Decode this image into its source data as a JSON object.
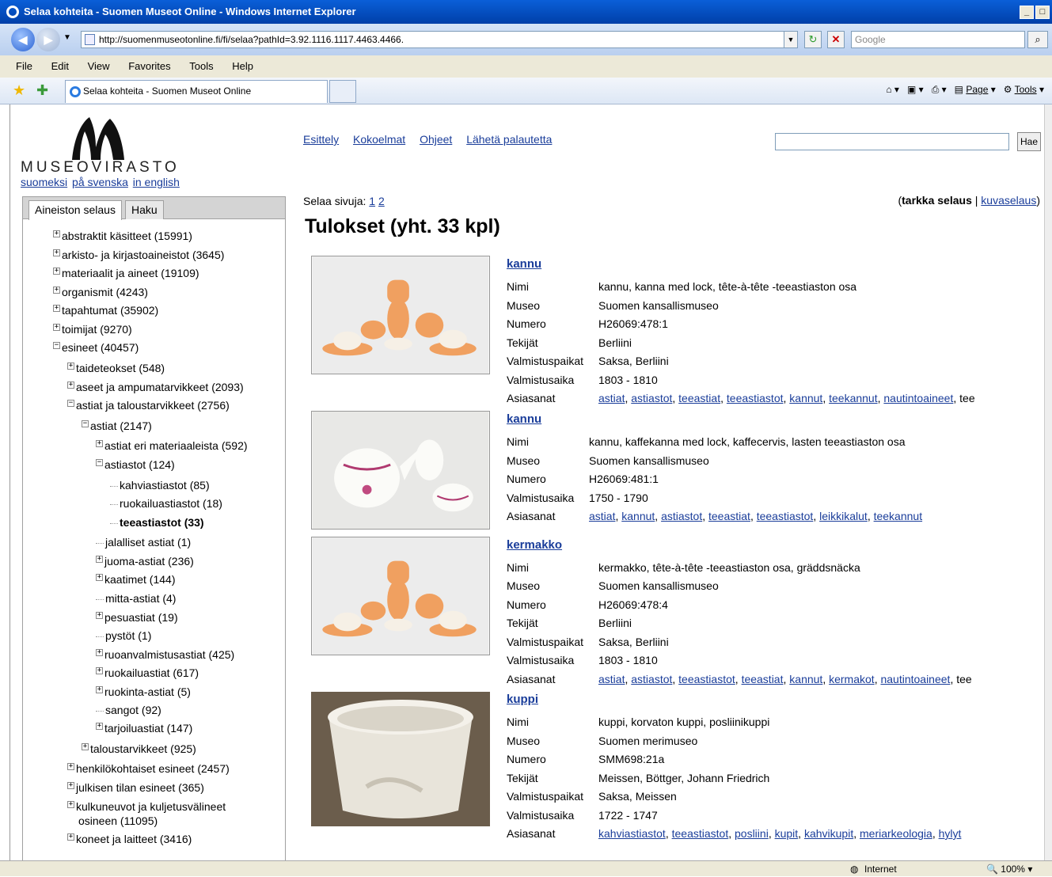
{
  "window": {
    "title": "Selaa kohteita - Suomen Museot Online - Windows Internet Explorer"
  },
  "address": {
    "url": "http://suomenmuseotonline.fi/fi/selaa?pathId=3.92.1116.1117.4463.4466.",
    "search_placeholder": "Google"
  },
  "menu": [
    "File",
    "Edit",
    "View",
    "Favorites",
    "Tools",
    "Help"
  ],
  "tab": {
    "title": "Selaa kohteita - Suomen Museot Online"
  },
  "commands": {
    "page": "Page",
    "tools": "Tools"
  },
  "status": {
    "zone": "Internet",
    "zoom": "100%"
  },
  "site": {
    "logo_text": "MUSEOVIRASTO",
    "languages": [
      "suomeksi",
      "på svenska",
      "in english"
    ],
    "nav": [
      "Esittely",
      "Kokoelmat",
      "Ohjeet",
      "Lähetä palautetta"
    ],
    "search_button": "Hae"
  },
  "sidebar": {
    "tabs": [
      "Aineiston selaus",
      "Haku"
    ],
    "tree": [
      {
        "label": "abstraktit käsitteet (15991)",
        "level": 0,
        "sign": "+"
      },
      {
        "label": "arkisto- ja kirjastoaineistot (3645)",
        "level": 0,
        "sign": "+"
      },
      {
        "label": "materiaalit ja aineet (19109)",
        "level": 0,
        "sign": "+"
      },
      {
        "label": "organismit (4243)",
        "level": 0,
        "sign": "+"
      },
      {
        "label": "tapahtumat (35902)",
        "level": 0,
        "sign": "+"
      },
      {
        "label": "toimijat (9270)",
        "level": 0,
        "sign": "+"
      },
      {
        "label": "esineet (40457)",
        "level": 0,
        "sign": "-"
      },
      {
        "label": "taideteokset (548)",
        "level": 1,
        "sign": "+"
      },
      {
        "label": "aseet ja ampumatarvikkeet (2093)",
        "level": 1,
        "sign": "+"
      },
      {
        "label": "astiat ja taloustarvikkeet (2756)",
        "level": 1,
        "sign": "-"
      },
      {
        "label": "astiat (2147)",
        "level": 2,
        "sign": "-"
      },
      {
        "label": "astiat eri materiaaleista (592)",
        "level": 3,
        "sign": "+"
      },
      {
        "label": "astiastot (124)",
        "level": 3,
        "sign": "-"
      },
      {
        "label": "kahviastiastot (85)",
        "level": 4,
        "sign": ""
      },
      {
        "label": "ruokailuastiastot (18)",
        "level": 4,
        "sign": ""
      },
      {
        "label": "teeastiastot (33)",
        "level": 4,
        "sign": "",
        "selected": true
      },
      {
        "label": "jalalliset astiat (1)",
        "level": 3,
        "sign": ""
      },
      {
        "label": "juoma-astiat (236)",
        "level": 3,
        "sign": "+"
      },
      {
        "label": "kaatimet (144)",
        "level": 3,
        "sign": "+"
      },
      {
        "label": "mitta-astiat (4)",
        "level": 3,
        "sign": ""
      },
      {
        "label": "pesuastiat (19)",
        "level": 3,
        "sign": "+"
      },
      {
        "label": "pystöt (1)",
        "level": 3,
        "sign": ""
      },
      {
        "label": "ruoanvalmistusastiat (425)",
        "level": 3,
        "sign": "+"
      },
      {
        "label": "ruokailuastiat (617)",
        "level": 3,
        "sign": "+"
      },
      {
        "label": "ruokinta-astiat (5)",
        "level": 3,
        "sign": "+"
      },
      {
        "label": "sangot (92)",
        "level": 3,
        "sign": ""
      },
      {
        "label": "tarjoiluastiat (147)",
        "level": 3,
        "sign": "+"
      },
      {
        "label": "taloustarvikkeet (925)",
        "level": 2,
        "sign": "+"
      },
      {
        "label": "henkilökohtaiset esineet (2457)",
        "level": 1,
        "sign": "+"
      },
      {
        "label": "julkisen tilan esineet (365)",
        "level": 1,
        "sign": "+"
      },
      {
        "label": "kulkuneuvot ja kuljetusvälineet",
        "label2": "osineen (11095)",
        "level": 1,
        "sign": "+"
      },
      {
        "label": "koneet ja laitteet (3416)",
        "level": 1,
        "sign": "+"
      }
    ]
  },
  "main": {
    "pages_label": "Selaa sivuja:",
    "pages": [
      "1",
      "2"
    ],
    "mode_current": "tarkka selaus",
    "mode_other": "kuvaselaus",
    "heading": "Tulokset (yht. 33 kpl)",
    "items": [
      {
        "title": "kannu",
        "fields": [
          {
            "k": "Nimi",
            "v": "kannu, kanna med lock, tête-à-tête -teeastiaston osa"
          },
          {
            "k": "Museo",
            "v": "Suomen kansallismuseo"
          },
          {
            "k": "Numero",
            "v": "H26069:478:1"
          },
          {
            "k": "Tekijät",
            "v": "Berliini"
          },
          {
            "k": "Valmistuspaikat",
            "v": "Saksa, Berliini"
          },
          {
            "k": "Valmistusaika",
            "v": "1803 - 1810"
          }
        ],
        "tags": [
          "astiat",
          "astiastot",
          "teeastiat",
          "teeastiastot",
          "kannut",
          "teekannut",
          "nautintoaineet"
        ],
        "tail": "tee"
      },
      {
        "title": "kannu",
        "fields": [
          {
            "k": "Nimi",
            "v": "kannu, kaffekanna med lock, kaffecervis, lasten teeastiaston osa"
          },
          {
            "k": "Museo",
            "v": "Suomen kansallismuseo"
          },
          {
            "k": "Numero",
            "v": "H26069:481:1"
          },
          {
            "k": "Valmistusaika",
            "v": "1750 - 1790"
          }
        ],
        "tags": [
          "astiat",
          "kannut",
          "astiastot",
          "teeastiat",
          "teeastiastot",
          "leikkikalut",
          "teekannut"
        ],
        "tail": ""
      },
      {
        "title": "kermakko",
        "fields": [
          {
            "k": "Nimi",
            "v": "kermakko, tête-à-tête -teeastiaston osa, gräddsnäcka"
          },
          {
            "k": "Museo",
            "v": "Suomen kansallismuseo"
          },
          {
            "k": "Numero",
            "v": "H26069:478:4"
          },
          {
            "k": "Tekijät",
            "v": "Berliini"
          },
          {
            "k": "Valmistuspaikat",
            "v": "Saksa, Berliini"
          },
          {
            "k": "Valmistusaika",
            "v": "1803 - 1810"
          }
        ],
        "tags": [
          "astiat",
          "astiastot",
          "teeastiastot",
          "teeastiat",
          "kannut",
          "kermakot",
          "nautintoaineet"
        ],
        "tail": "tee"
      },
      {
        "title": "kuppi",
        "fields": [
          {
            "k": "Nimi",
            "v": "kuppi, korvaton kuppi, posliinikuppi"
          },
          {
            "k": "Museo",
            "v": "Suomen merimuseo"
          },
          {
            "k": "Numero",
            "v": "SMM698:21a"
          },
          {
            "k": "Tekijät",
            "v": "Meissen, Böttger, Johann Friedrich"
          },
          {
            "k": "Valmistuspaikat",
            "v": "Saksa, Meissen"
          },
          {
            "k": "Valmistusaika",
            "v": "1722 - 1747"
          }
        ],
        "tags": [
          "kahviastiastot",
          "teeastiastot",
          "posliini",
          "kupit",
          "kahvikupit",
          "meriarkeologia",
          "hylyt"
        ],
        "tail": ""
      }
    ],
    "tags_key": "Asiasanat"
  }
}
